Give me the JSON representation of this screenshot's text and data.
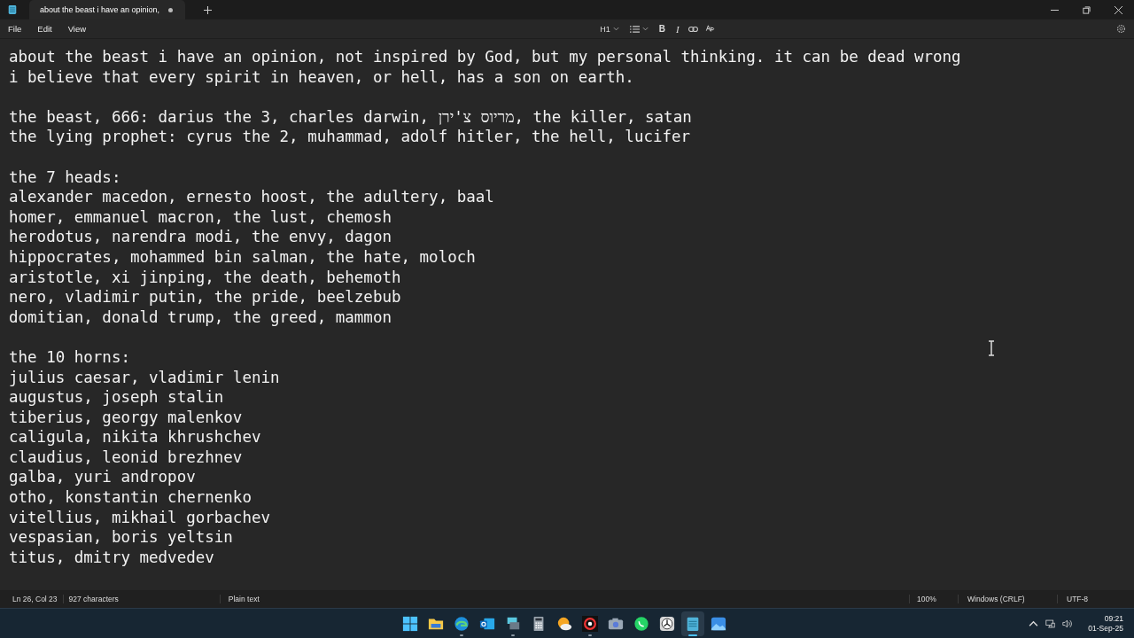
{
  "window": {
    "tab_title": "about the beast i have an opinion,",
    "modified": true
  },
  "menu": [
    "File",
    "Edit",
    "View"
  ],
  "toolbar": {
    "heading": "H1",
    "bold": "B",
    "italic": "I"
  },
  "document": {
    "blocks": [
      [
        "about the beast i have an opinion, not inspired by God, but my personal thinking. it can be dead wrong",
        "i believe that every spirit in heaven, or hell, has a son on earth."
      ],
      [
        "the beast, 666: darius the 3, charles darwin, מריוס צ'ירן, the killer, satan",
        "the lying prophet: cyrus the 2, muhammad, adolf hitler, the hell, lucifer"
      ],
      [
        "the 7 heads:",
        "alexander macedon, ernesto hoost, the adultery, baal",
        "homer, emmanuel macron, the lust, chemosh",
        "herodotus, narendra modi, the envy, dagon",
        "hippocrates, mohammed bin salman, the hate, moloch",
        "aristotle, xi jinping, the death, behemoth",
        "nero, vladimir putin, the pride, beelzebub",
        "domitian, donald trump, the greed, mammon"
      ],
      [
        "the 10 horns:",
        "julius caesar, vladimir lenin",
        "augustus, joseph stalin",
        "tiberius, georgy malenkov",
        "caligula, nikita khrushchev",
        "claudius, leonid brezhnev",
        "galba, yuri andropov",
        "otho, konstantin chernenko",
        "vitellius, mikhail gorbachev",
        "vespasian, boris yeltsin",
        "titus, dmitry medvedev"
      ]
    ]
  },
  "status_bar": {
    "position": "Ln 26, Col 23",
    "characters": "927 characters",
    "format": "Plain text",
    "zoom": "100%",
    "line_ending": "Windows (CRLF)",
    "encoding": "UTF-8"
  },
  "taskbar": {
    "apps": [
      {
        "kind": "start",
        "running": false,
        "active": false
      },
      {
        "kind": "folder",
        "running": false,
        "active": false
      },
      {
        "kind": "browser",
        "running": true,
        "active": false
      },
      {
        "kind": "mail",
        "running": false,
        "active": false
      },
      {
        "kind": "remote",
        "running": true,
        "active": false
      },
      {
        "kind": "calculator",
        "running": false,
        "active": false
      },
      {
        "kind": "weather",
        "running": false,
        "active": false
      },
      {
        "kind": "sync",
        "running": true,
        "active": false
      },
      {
        "kind": "camera",
        "running": false,
        "active": false
      },
      {
        "kind": "chat",
        "running": false,
        "active": false
      },
      {
        "kind": "clock",
        "running": false,
        "active": false
      },
      {
        "kind": "notepad",
        "running": true,
        "active": true
      },
      {
        "kind": "photos",
        "running": false,
        "active": false
      }
    ],
    "time": "09:21",
    "date": "01-Sep-25"
  }
}
